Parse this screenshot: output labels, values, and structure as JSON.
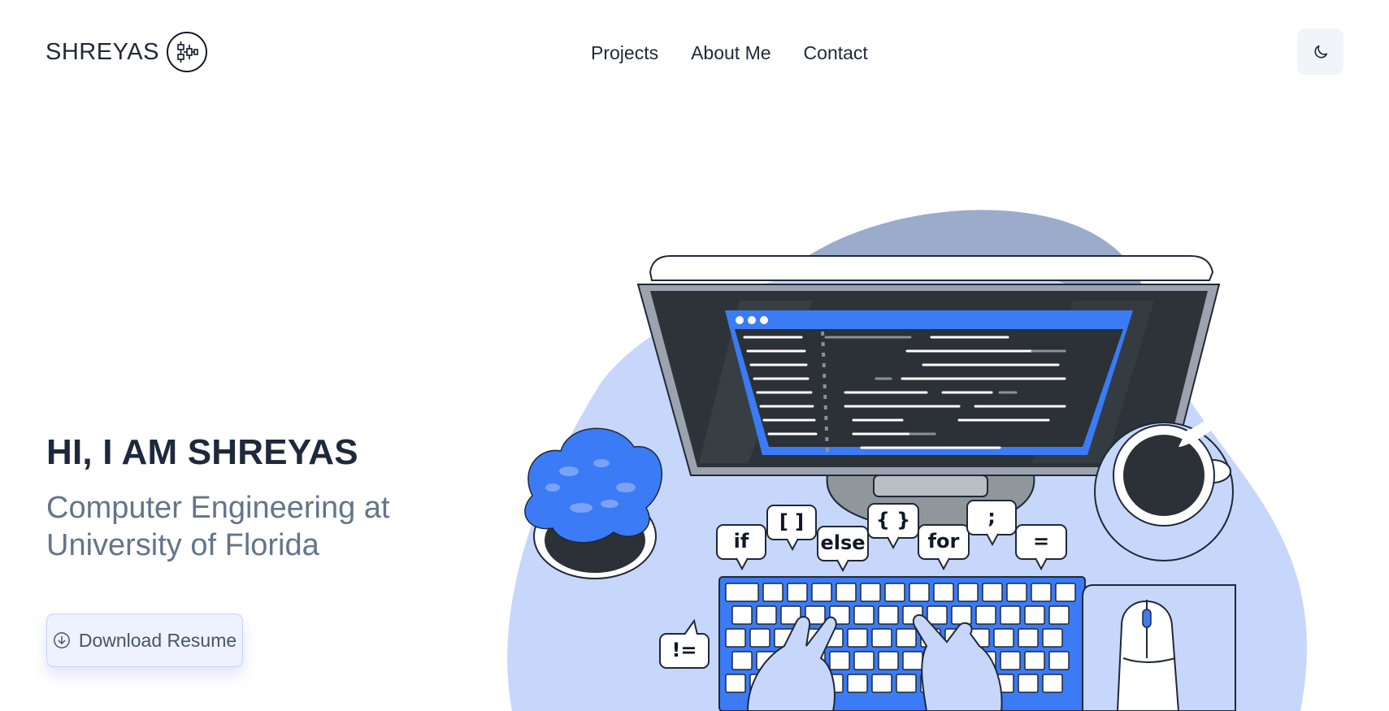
{
  "header": {
    "brand_name": "SHREYAS",
    "brand_icon": "circuit-logo-icon",
    "nav": [
      "Projects",
      "About Me",
      "Contact"
    ],
    "theme_toggle_icon": "moon-icon"
  },
  "hero": {
    "title": "HI, I AM SHREYAS",
    "subtitle_line1": "Computer Engineering at",
    "subtitle_line2": "University of Florida",
    "resume_button": "Download Resume",
    "resume_icon": "download-circle-icon"
  },
  "illustration": {
    "bubbles": [
      "if",
      "[ ]",
      "else",
      "{ }",
      "for",
      ";",
      "=",
      "!="
    ]
  },
  "colors": {
    "primary_blue": "#3b7bf6",
    "light_blue": "#c7d6fb",
    "dark_blob": "#9aabcb",
    "text_dark": "#1e293b",
    "text_muted": "#64748b"
  }
}
